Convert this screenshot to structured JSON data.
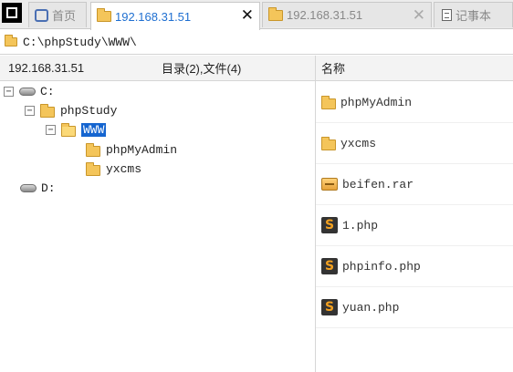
{
  "tabs": [
    {
      "label": "首页"
    },
    {
      "label": "192.168.31.51",
      "active": true
    },
    {
      "label": "192.168.31.51"
    },
    {
      "label": "记事本"
    }
  ],
  "colors": {
    "accent": "#1f6fd1",
    "selection": "#1565d0",
    "folder": "#f4c55a"
  },
  "path": "C:\\phpStudy\\WWW\\",
  "header": {
    "host": "192.168.31.51",
    "counts": "目录(2),文件(4)",
    "name_col": "名称"
  },
  "tree": {
    "drive_c": "C:",
    "phpstudy": "phpStudy",
    "www": "WWW",
    "phpmyadmin": "phpMyAdmin",
    "yxcms": "yxcms",
    "drive_d": "D:"
  },
  "files": [
    {
      "name": "phpMyAdmin",
      "icon": "folder-icon"
    },
    {
      "name": "yxcms",
      "icon": "folder-icon"
    },
    {
      "name": "beifen.rar",
      "icon": "archive-icon"
    },
    {
      "name": "1.php",
      "icon": "php-file-icon"
    },
    {
      "name": "phpinfo.php",
      "icon": "php-file-icon"
    },
    {
      "name": "yuan.php",
      "icon": "php-file-icon"
    }
  ]
}
